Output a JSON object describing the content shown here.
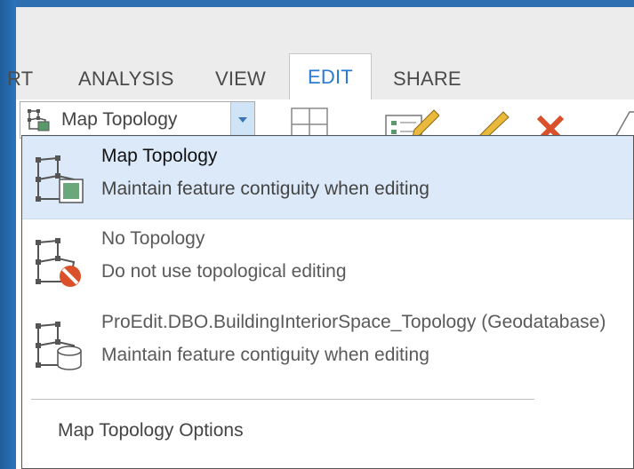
{
  "ribbon_tabs": [
    {
      "label": "RT",
      "active": false
    },
    {
      "label": "ANALYSIS",
      "active": false
    },
    {
      "label": "VIEW",
      "active": false
    },
    {
      "label": "EDIT",
      "active": true
    },
    {
      "label": "SHARE",
      "active": false
    }
  ],
  "topology_combo": {
    "selected_value": "Map Topology",
    "icon": "topology-icon"
  },
  "menu": {
    "items": [
      {
        "title": "Map Topology",
        "description": "Maintain feature contiguity when editing",
        "icon": "map-topology-icon",
        "selected": true
      },
      {
        "title": "No Topology",
        "description": "Do not use topological editing",
        "icon": "no-topology-icon",
        "selected": false
      },
      {
        "title": "ProEdit.DBO.BuildingInteriorSpace_Topology (Geodatabase)",
        "description": "Maintain feature contiguity when editing",
        "icon": "geodatabase-topology-icon",
        "selected": false
      }
    ],
    "options_label": "Map Topology Options"
  },
  "colors": {
    "accent": "#2a7ad4",
    "selection": "#dbe9f8",
    "window_blue": "#2d6fb0"
  }
}
